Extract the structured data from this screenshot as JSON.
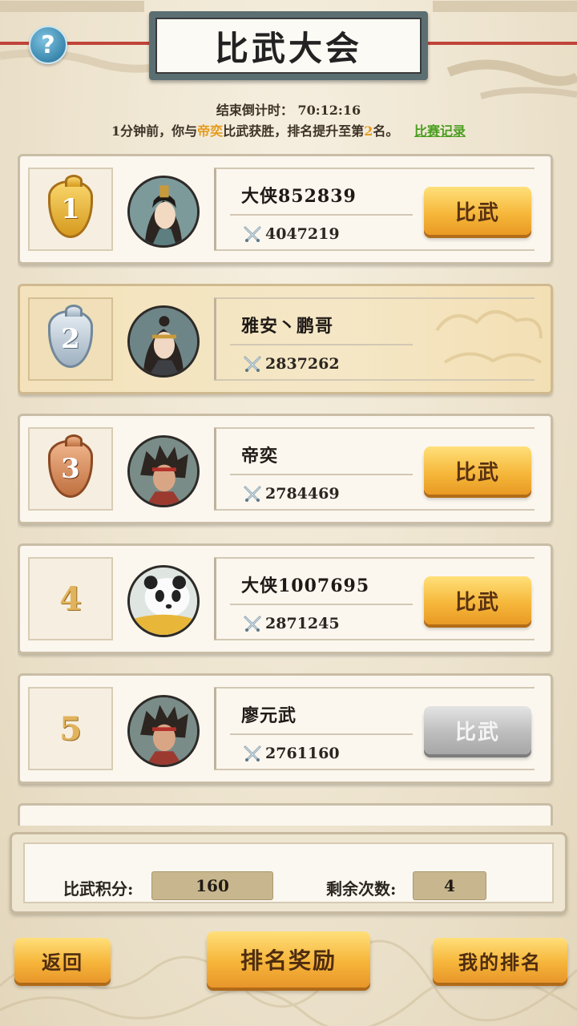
{
  "header": {
    "title": "比武大会",
    "help_icon": "question-icon",
    "countdown_label": "结束倒计时：",
    "countdown_value": "70:12:16",
    "notice_prefix": "1分钟前，你与",
    "notice_opponent": "帝奕",
    "notice_middle": "比武获胜，排名提升至第",
    "notice_rank": "2",
    "notice_suffix": "名。",
    "record_link": "比赛记录"
  },
  "colors": {
    "highlight": "#e49b1e",
    "link": "#4a9e1f",
    "button": "#f6b83b",
    "button_disabled": "#bdbdbd"
  },
  "rankings": [
    {
      "rank": "1",
      "badge": "gold",
      "name": "大侠852839",
      "power": "4047219",
      "button": "比武",
      "button_state": "enabled",
      "avatar": "warrior-crown-avatar"
    },
    {
      "rank": "2",
      "badge": "silver",
      "name": "雅安丶鹏哥",
      "power": "2837262",
      "button": "",
      "button_state": "self",
      "avatar": "warrior-headband-avatar"
    },
    {
      "rank": "3",
      "badge": "bronze",
      "name": "帝奕",
      "power": "2784469",
      "button": "比武",
      "button_state": "enabled",
      "avatar": "warrior-red-avatar"
    },
    {
      "rank": "4",
      "badge": "plain",
      "name": "大侠1007695",
      "power": "2871245",
      "button": "比武",
      "button_state": "enabled",
      "avatar": "panda-avatar"
    },
    {
      "rank": "5",
      "badge": "plain",
      "name": "廖元武",
      "power": "2761160",
      "button": "比武",
      "button_state": "disabled",
      "avatar": "warrior-red-avatar"
    }
  ],
  "score": {
    "points_label": "比武积分:",
    "points_value": "160",
    "remaining_label": "剩余次数:",
    "remaining_value": "4"
  },
  "footer": {
    "back": "返回",
    "rewards": "排名奖励",
    "my_rank": "我的排名"
  }
}
